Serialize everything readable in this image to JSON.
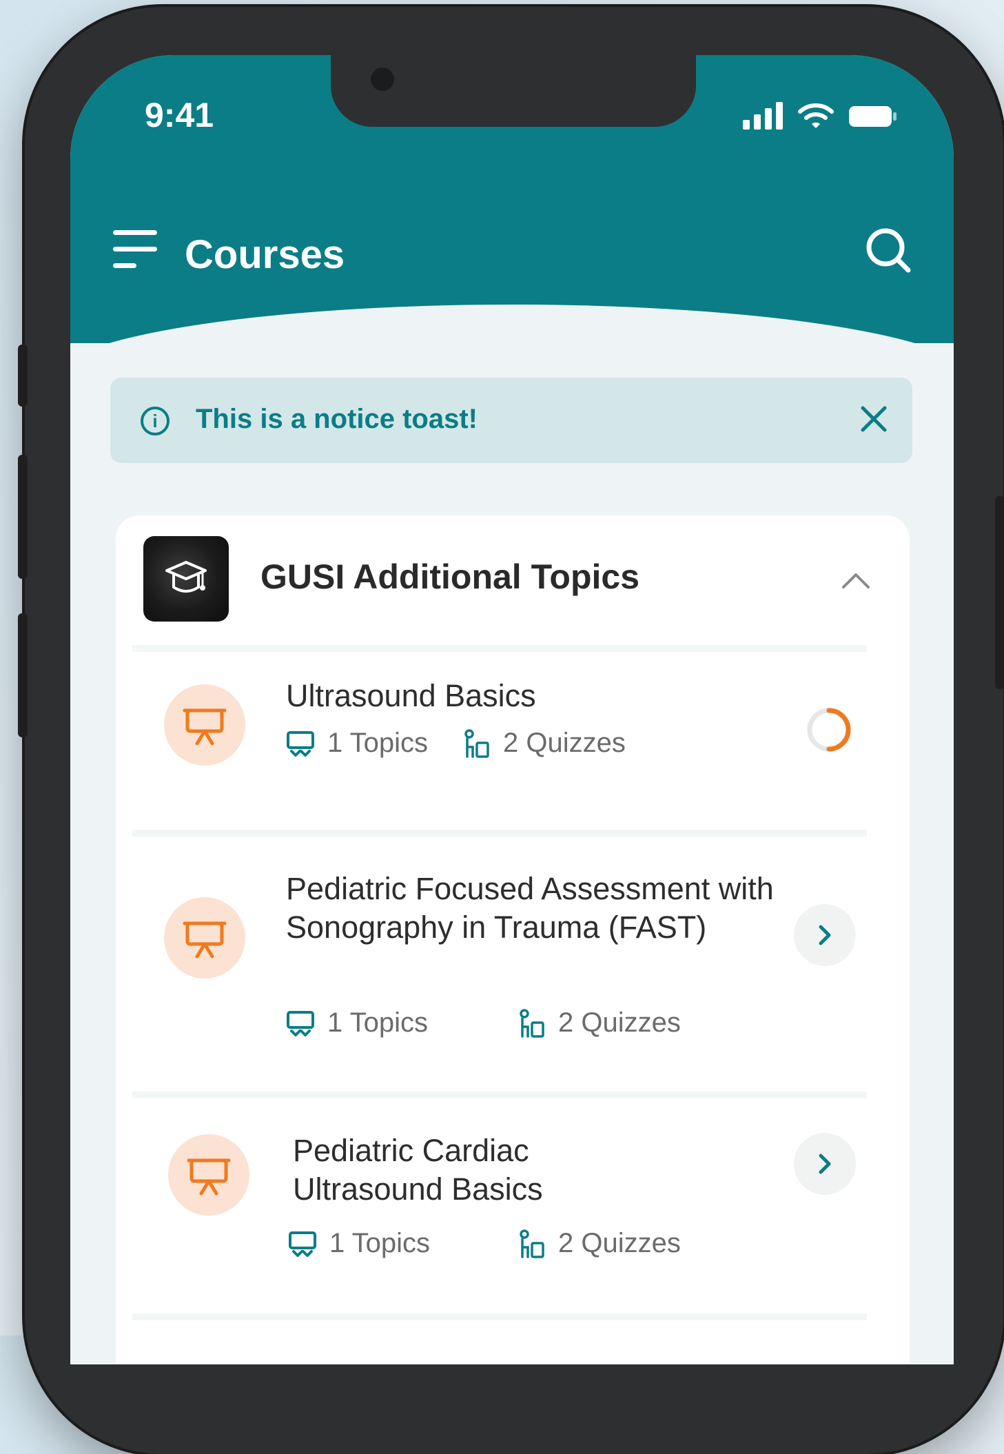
{
  "status_bar": {
    "time": "9:41"
  },
  "header": {
    "title": "Courses"
  },
  "toast": {
    "text": "This is a notice toast!"
  },
  "course": {
    "title": "GUSI Additional Topics",
    "lessons": [
      {
        "title": "Ultrasound Basics",
        "topics": "1 Topics",
        "quizzes": "2 Quizzes",
        "status": "in-progress"
      },
      {
        "title": "Pediatric Focused Assessment with Sonography in Trauma (FAST)",
        "topics": "1 Topics",
        "quizzes": "2 Quizzes",
        "status": "open"
      },
      {
        "title": "Pediatric Cardiac Ultrasound Basics",
        "topics": "1 Topics",
        "quizzes": "2 Quizzes",
        "status": "open"
      }
    ]
  },
  "colors": {
    "primary": "#0b7d86",
    "accent": "#f07a1f",
    "accent_bg": "#fbe2d2"
  }
}
